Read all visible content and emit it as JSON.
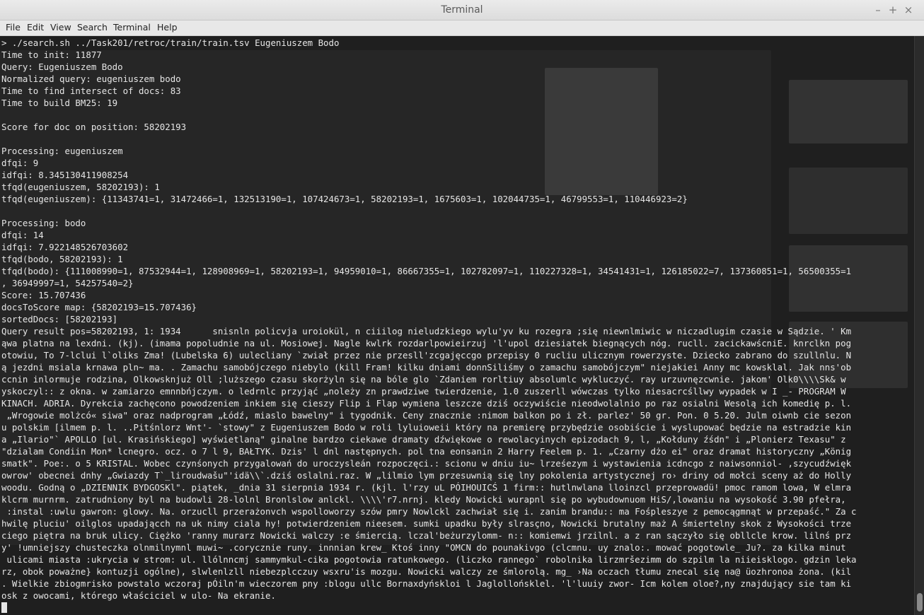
{
  "window": {
    "title": "Terminal",
    "controls": {
      "minimize": "–",
      "maximize": "+",
      "close": "×"
    }
  },
  "menu": [
    "File",
    "Edit",
    "View",
    "Search",
    "Terminal",
    "Help"
  ],
  "terminal": {
    "lines": [
      "> ./search.sh ../Task201/retroc/train/train.tsv Eugeniuszem Bodo",
      "Time to init: 11877",
      "Query: Eugeniuszem Bodo",
      "Normalized query: eugeniuszem bodo",
      "Time to find intersect of docs: 83",
      "Time to build BM25: 19",
      "",
      "Score for doc on position: 58202193",
      "",
      "Processing: eugeniuszem",
      "dfqi: 9",
      "idfqi: 8.345130411908254",
      "tfqd(eugeniuszem, 58202193): 1",
      "tfqd(eugeniuszem): {11343741=1, 31472466=1, 132513190=1, 107424673=1, 58202193=1, 1675603=1, 102044735=1, 46799553=1, 110446923=2}",
      "",
      "Processing: bodo",
      "dfqi: 14",
      "idfqi: 7.922148526703602",
      "tfqd(bodo, 58202193): 1",
      "tfqd(bodo): {111008990=1, 87532944=1, 128908969=1, 58202193=1, 94959010=1, 86667355=1, 102782097=1, 110227328=1, 34541431=1, 126185022=7, 137360851=1, 56500355=1",
      ", 36949997=1, 54257540=2}",
      "Score: 15.707436",
      "docsToScore map: {58202193=15.707436}",
      "sortedDocs: [58202193]",
      "Query result pos=58202193, 1: 1934      snisnln policvja uroiokül, n ciiilog nieludzkiego wylu'yv ku rozegra ;się niewnlmiwic w niczadlugim czasie w Sądzie. ' Km",
      "ąwa platna na lexdni. (kj). (imama popoludnie na ul. Mosiowej. Nagle kwlrk rozdarlpowieirzuj 'l'upol dziesiatek biegnących nóg. rucll. zacickawścniE. knrclkn pog",
      "otowiu, To 7-lclui l`oliks Zma! (Lubelska 6) uulecliany `zwiał przez nie przesll'zcgajęccgo przepisy 0 rucliu ulicznym rowerzyste. Dziecko zabrano do szullnlu. N",
      "ą jezdni msiala krnawa pln~ ma. . Zamachu samobójczego niebylo (kill Fram! kilku dniami donnSiliśmy o zamachu samobójczym\" niejakiei Anny mc kowsklal. Jak nns'ob",
      "ccnin inlormuje rodzina, Olkowsknjuż Oll ;luższego czasu skorżyln się na bóle glo `Zdaniem rorltiuy absolumlc wykluczyć. ray urzuvnęzcwnie. jakom' Olk0\\\\\\\\Sk& w",
      "yskoczyl:: z okna. w zamiarzo emnnbńjczym. o ledrnlc przyjąć „noleży zn prawdziwe twierdzenie, 1.0 zuszerll wówczas tylko niesacrcśllwy wypadek w I _- PROGRAM W",
      "KINACH. ADRIA. Dyrekcia zachęcono powodzeniem inkiem się cieszy Flip i Flap wymiena leszcze dziś oczywiście nieodwolalnio po raz osialni Wesolą ich komedię p. l.",
      " „Wrogowie molżcó« siwa\" oraz nadprogram „Łódź, miaslo bawelny\" i tygodnik. Ceny znacznie :nimom balkon po i zł. parlez' 50 gr. Pon. 0 5.20. Julm oiwnb cie sezon",
      "u polskim [ilmem p. l. ..Pitśnlorz Wnt'- `stowy\" z Eugeniuszem Bodo w roli lyluioweii który na premierę przybędzie osobiście i wyslupować będzie na estradzie kin",
      "a „Ilario\"` APOLLO [ul. Krasińskiego] wyświetlaną\" ginalne bardzo ciekawe dramaty dźwiękowe o rewolacyinych epizodach 9, l, „Kołduny źśdn\" i „Plonierz Texasu\" z",
      "\"dzialam Condiin Mon* lcnegro. ocz. o 7 l 9, BAŁTYK. Dzis' l dnl następnych. pol tna eonsanin 2 Harry Feelem p. 1. „Czarny dżo ei\" oraz dramat historyczny „König",
      "smatk\". Poe:. o 5 KRISTAL. Wobec czynśonych przygalowań do uroczysleán rozpoczęci.: scionu w dniu iu~ lrześezym i wystawienia icdncgo z naiwsonniol- ,szycudźwięk",
      "owrow' obecnei dnhy „Gwiazdy T`_liroudwašu\"'idä\\\\`.dziś oslalni.raz. W „lilmio lym przesuwnią się lny pokolenia artystycznej ro› driny od mołci sceny aż do Holly",
      "woodu. Godną o „DZIENNIK BYDGOSKl\". piątek, _dnia 31 sierpnia 1934 r. (kjl. l'rzy uL PÓIHOUICŚ 1 firm:: hutlnwlana lloinzcl przeprowadü! pmoc ramom lowa, W elmra",
      "klcrm murnrm. zatrudniony byl na budowli 28-lolnl Bronlslow anlckl. \\\\\\\\'r7.nrnj. kledy Nowicki wurapnl się po wybudownuom HiS/,lowaniu na wysokość 3.90 pfełra,",
      " :instal :uwlu gawron: glowy. Na. orzucll przerażonvch wspolloworzy szów pmry Nowlckl zachwiał się i. zanim brandu:: ma Fośpleszye z pemocągmnąt w przepaść.\" Za c",
      "hwilę pluciu' oilglos upadającch na uk nimy ciala hy! potwierdzeniem nieesem. sumki upadku były slrasçno, Nowicki brutalny maż A śmiertelny skok z Wysokości trze",
      "ciego piętra na bruk ulicy. Ciężko 'ranny murarz Nowicki walczy :e śmiercią. lczal'beżurzylomm- n:: komiemwi jrzilnl. a z ran sączyło się obllcle krow. lilnś prz",
      "y' !umniejszy chusteczka olnmilnymnl muwi~ .corycznie runy. innnian krew_ Ktoś inny \"OMCN do pounakivgo (clcmnu. uy znalo:. mować pogotowle_ Ju?. za kilka minut",
      " ulicami miasta :ukrycia w strom: ul. llólnncmj sammymkul-cika pogotowia ratunkowego. (liczko rannego` robolnika lirzmršezimm do szpilm la niieisklogo. gdzin leka",
      "rz, obok poważne} kontuzji ogólne), slwlenlzll niebezplcczuy wsxru'is mozgu. Nowicki walczy ze śmlorolą. mg_ ›Na oczach tłumu znecal się na@ üozhronoa żona. (kil",
      ". Wielkie zbiogmrisko powstalo wczoraj pÓiln'm wieczorem pny :blogu ullc Bornaxdyńskloi l Jaglollońsklel. 'l'luuiy zwor- Icm kolem oloe?,ny znajdujący sie tam ki",
      "osk z owocami, którego właściciel w ulo- Na ekranie.",
      ""
    ]
  }
}
